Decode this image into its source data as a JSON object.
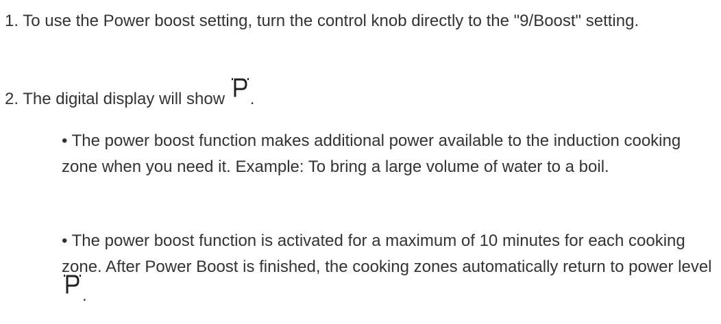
{
  "document": {
    "step1": "1. To use the Power boost setting, turn the control knob directly to the \"9/Boost\" setting.",
    "step2_before": "2. The digital display will show",
    "step2_after": ".",
    "bullet1": "• The power boost function makes additional power available to the induction cooking zone when you need it. Example: To bring a large volume of water to a boil.",
    "bullet2_before": "• The power boost function is activated for a maximum of 10 minutes for each cooking zone. After Power Boost is finished, the cooking zones automatically return to power level",
    "bullet2_after": "."
  },
  "icons": {
    "display_symbol": "p-display-icon"
  },
  "colors": {
    "text": "#333333",
    "background": "#ffffff"
  }
}
